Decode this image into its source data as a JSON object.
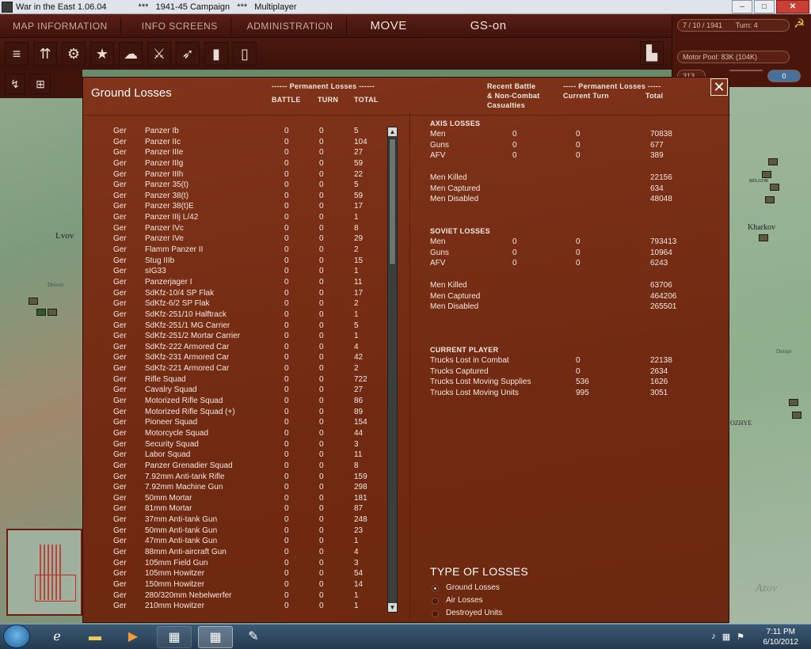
{
  "window": {
    "app_title": "War in the East 1.06.04",
    "campaign_title": "***   1941-45 Campaign   ***   Multiplayer",
    "buttons": {
      "minimize": "–",
      "maximize": "□",
      "close": "✕"
    }
  },
  "game_menu": {
    "items": [
      "MAP INFORMATION",
      "INFO SCREENS",
      "ADMINISTRATION",
      "MOVE",
      "GS-on"
    ]
  },
  "status": {
    "date": "7 / 10 / 1941",
    "turn": "Turn: 4",
    "motor_pool": "Motor Pool:  83K (104K)",
    "value": "313",
    "indicator": "0"
  },
  "map": {
    "labels": [
      "Lvov",
      "Kharkov",
      "BELGOR",
      "OZHYE",
      "Azov",
      "Dniestr",
      "Dniepr"
    ]
  },
  "dialog": {
    "title": "Ground Losses",
    "close": "✕",
    "left_headers": {
      "perm": "------ Permanent Losses ------",
      "battle": "BATTLE",
      "turn": "TURN",
      "total": "TOTAL"
    },
    "right_headers": {
      "recent1": "Recent Battle",
      "recent2": "& Non-Combat",
      "recent3": "Casualties",
      "perm": "----- Permanent Losses -----",
      "current_turn": "Current Turn",
      "total": "Total"
    },
    "rows": [
      {
        "nat": "Ger",
        "name": "Panzer Ib",
        "b": "0",
        "t": "0",
        "tot": "5"
      },
      {
        "nat": "Ger",
        "name": "Panzer IIc",
        "b": "0",
        "t": "0",
        "tot": "104"
      },
      {
        "nat": "Ger",
        "name": "Panzer IIIe",
        "b": "0",
        "t": "0",
        "tot": "27"
      },
      {
        "nat": "Ger",
        "name": "Panzer IIIg",
        "b": "0",
        "t": "0",
        "tot": "59"
      },
      {
        "nat": "Ger",
        "name": "Panzer IIIh",
        "b": "0",
        "t": "0",
        "tot": "22"
      },
      {
        "nat": "Ger",
        "name": "Panzer 35(t)",
        "b": "0",
        "t": "0",
        "tot": "5"
      },
      {
        "nat": "Ger",
        "name": "Panzer 38(t)",
        "b": "0",
        "t": "0",
        "tot": "59"
      },
      {
        "nat": "Ger",
        "name": "Panzer 38(t)E",
        "b": "0",
        "t": "0",
        "tot": "17"
      },
      {
        "nat": "Ger",
        "name": "Panzer IIIj L/42",
        "b": "0",
        "t": "0",
        "tot": "1"
      },
      {
        "nat": "Ger",
        "name": "Panzer IVc",
        "b": "0",
        "t": "0",
        "tot": "8"
      },
      {
        "nat": "Ger",
        "name": "Panzer IVe",
        "b": "0",
        "t": "0",
        "tot": "29"
      },
      {
        "nat": "Ger",
        "name": "Flamm Panzer II",
        "b": "0",
        "t": "0",
        "tot": "2"
      },
      {
        "nat": "Ger",
        "name": "Stug IIIb",
        "b": "0",
        "t": "0",
        "tot": "15"
      },
      {
        "nat": "Ger",
        "name": "sIG33",
        "b": "0",
        "t": "0",
        "tot": "1"
      },
      {
        "nat": "Ger",
        "name": "Panzerjager I",
        "b": "0",
        "t": "0",
        "tot": "11"
      },
      {
        "nat": "Ger",
        "name": "SdKfz-10/4 SP Flak",
        "b": "0",
        "t": "0",
        "tot": "17"
      },
      {
        "nat": "Ger",
        "name": "SdKfz-6/2 SP Flak",
        "b": "0",
        "t": "0",
        "tot": "2"
      },
      {
        "nat": "Ger",
        "name": "SdKfz-251/10 Halftrack",
        "b": "0",
        "t": "0",
        "tot": "1"
      },
      {
        "nat": "Ger",
        "name": "SdKfz-251/1 MG Carrier",
        "b": "0",
        "t": "0",
        "tot": "5"
      },
      {
        "nat": "Ger",
        "name": "SdKfz-251/2 Mortar Carrier",
        "b": "0",
        "t": "0",
        "tot": "1"
      },
      {
        "nat": "Ger",
        "name": "SdKfz-222 Armored Car",
        "b": "0",
        "t": "0",
        "tot": "4"
      },
      {
        "nat": "Ger",
        "name": "SdKfz-231 Armored Car",
        "b": "0",
        "t": "0",
        "tot": "42"
      },
      {
        "nat": "Ger",
        "name": "SdKfz-221 Armored Car",
        "b": "0",
        "t": "0",
        "tot": "2"
      },
      {
        "nat": "Ger",
        "name": "Rifle Squad",
        "b": "0",
        "t": "0",
        "tot": "722"
      },
      {
        "nat": "Ger",
        "name": "Cavalry Squad",
        "b": "0",
        "t": "0",
        "tot": "27"
      },
      {
        "nat": "Ger",
        "name": "Motorized Rifle Squad",
        "b": "0",
        "t": "0",
        "tot": "86"
      },
      {
        "nat": "Ger",
        "name": "Motorized Rifle Squad (+)",
        "b": "0",
        "t": "0",
        "tot": "89"
      },
      {
        "nat": "Ger",
        "name": "Pioneer Squad",
        "b": "0",
        "t": "0",
        "tot": "154"
      },
      {
        "nat": "Ger",
        "name": "Motorcycle Squad",
        "b": "0",
        "t": "0",
        "tot": "44"
      },
      {
        "nat": "Ger",
        "name": "Security Squad",
        "b": "0",
        "t": "0",
        "tot": "3"
      },
      {
        "nat": "Ger",
        "name": "Labor Squad",
        "b": "0",
        "t": "0",
        "tot": "11"
      },
      {
        "nat": "Ger",
        "name": "Panzer Grenadier Squad",
        "b": "0",
        "t": "0",
        "tot": "8"
      },
      {
        "nat": "Ger",
        "name": "7.92mm Anti-tank Rifle",
        "b": "0",
        "t": "0",
        "tot": "159"
      },
      {
        "nat": "Ger",
        "name": "7.92mm Machine Gun",
        "b": "0",
        "t": "0",
        "tot": "298"
      },
      {
        "nat": "Ger",
        "name": "50mm Mortar",
        "b": "0",
        "t": "0",
        "tot": "181"
      },
      {
        "nat": "Ger",
        "name": "81mm Mortar",
        "b": "0",
        "t": "0",
        "tot": "87"
      },
      {
        "nat": "Ger",
        "name": "37mm Anti-tank Gun",
        "b": "0",
        "t": "0",
        "tot": "248"
      },
      {
        "nat": "Ger",
        "name": "50mm Anti-tank Gun",
        "b": "0",
        "t": "0",
        "tot": "23"
      },
      {
        "nat": "Ger",
        "name": "47mm Anti-tank Gun",
        "b": "0",
        "t": "0",
        "tot": "1"
      },
      {
        "nat": "Ger",
        "name": "88mm Anti-aircraft Gun",
        "b": "0",
        "t": "0",
        "tot": "4"
      },
      {
        "nat": "Ger",
        "name": "105mm Field Gun",
        "b": "0",
        "t": "0",
        "tot": "3"
      },
      {
        "nat": "Ger",
        "name": "105mm Howitzer",
        "b": "0",
        "t": "0",
        "tot": "54"
      },
      {
        "nat": "Ger",
        "name": "150mm Howitzer",
        "b": "0",
        "t": "0",
        "tot": "14"
      },
      {
        "nat": "Ger",
        "name": "280/320mm Nebelwerfer",
        "b": "0",
        "t": "0",
        "tot": "1"
      },
      {
        "nat": "Ger",
        "name": "210mm Howitzer",
        "b": "0",
        "t": "0",
        "tot": "1"
      }
    ],
    "axis": {
      "title": "AXIS LOSSES",
      "rows": [
        {
          "label": "Men",
          "recent": "0",
          "cur": "0",
          "tot": "70838"
        },
        {
          "label": "Guns",
          "recent": "0",
          "cur": "0",
          "tot": "677"
        },
        {
          "label": "AFV",
          "recent": "0",
          "cur": "0",
          "tot": "389"
        }
      ],
      "casualties": [
        {
          "label": "Men Killed",
          "tot": "22156"
        },
        {
          "label": "Men Captured",
          "tot": "634"
        },
        {
          "label": "Men Disabled",
          "tot": "48048"
        }
      ]
    },
    "soviet": {
      "title": "SOVIET LOSSES",
      "rows": [
        {
          "label": "Men",
          "recent": "0",
          "cur": "0",
          "tot": "793413"
        },
        {
          "label": "Guns",
          "recent": "0",
          "cur": "0",
          "tot": "10964"
        },
        {
          "label": "AFV",
          "recent": "0",
          "cur": "0",
          "tot": "6243"
        }
      ],
      "casualties": [
        {
          "label": "Men Killed",
          "tot": "63706"
        },
        {
          "label": "Men Captured",
          "tot": "464206"
        },
        {
          "label": "Men Disabled",
          "tot": "265501"
        }
      ]
    },
    "current_player": {
      "title": "CURRENT PLAYER",
      "rows": [
        {
          "label": "Trucks Lost in Combat",
          "cur": "0",
          "tot": "22138"
        },
        {
          "label": "Trucks Captured",
          "cur": "0",
          "tot": "2634"
        },
        {
          "label": "Trucks Lost Moving Supplies",
          "cur": "536",
          "tot": "1626"
        },
        {
          "label": "Trucks Lost Moving Units",
          "cur": "995",
          "tot": "3051"
        }
      ]
    },
    "type_of_losses": {
      "title": "TYPE OF LOSSES",
      "options": [
        "Ground Losses",
        "Air Losses",
        "Destroyed Units"
      ],
      "selected": "Ground Losses"
    }
  },
  "taskbar": {
    "time": "7:11 PM",
    "date": "6/10/2012"
  }
}
